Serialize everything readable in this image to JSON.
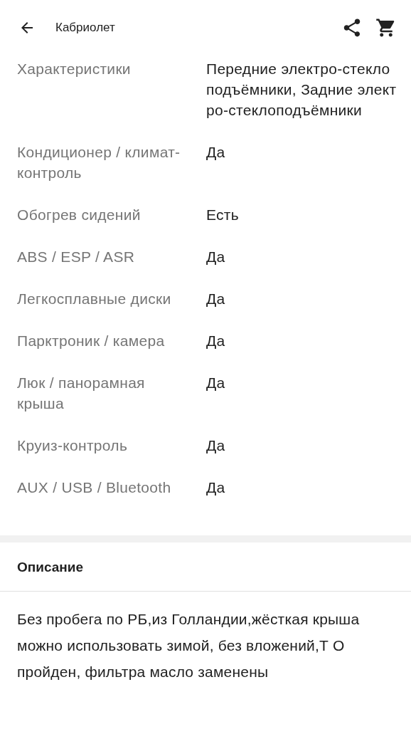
{
  "header": {
    "title": "Кабриолет"
  },
  "specs": [
    {
      "label": "Характеристики",
      "value": "Передние электро-стеклоподъёмники, Задние электро-стеклоподъёмники"
    },
    {
      "label": "Кондиционер / климат-контроль",
      "value": "Да"
    },
    {
      "label": "Обогрев сидений",
      "value": "Есть"
    },
    {
      "label": "ABS / ESP / ASR",
      "value": "Да"
    },
    {
      "label": "Легкосплавные диски",
      "value": "Да"
    },
    {
      "label": "Парктроник / камера",
      "value": "Да"
    },
    {
      "label": "Люк / панорамная крыша",
      "value": "Да"
    },
    {
      "label": "Круиз-контроль",
      "value": "Да"
    },
    {
      "label": "AUX / USB / Bluetooth",
      "value": "Да"
    }
  ],
  "description": {
    "title": "Описание",
    "text": "Без пробега по РБ,из Голландии,жёсткая крыша можно использовать зимой, без вложений,Т О пройден, фильтра масло заменены"
  }
}
